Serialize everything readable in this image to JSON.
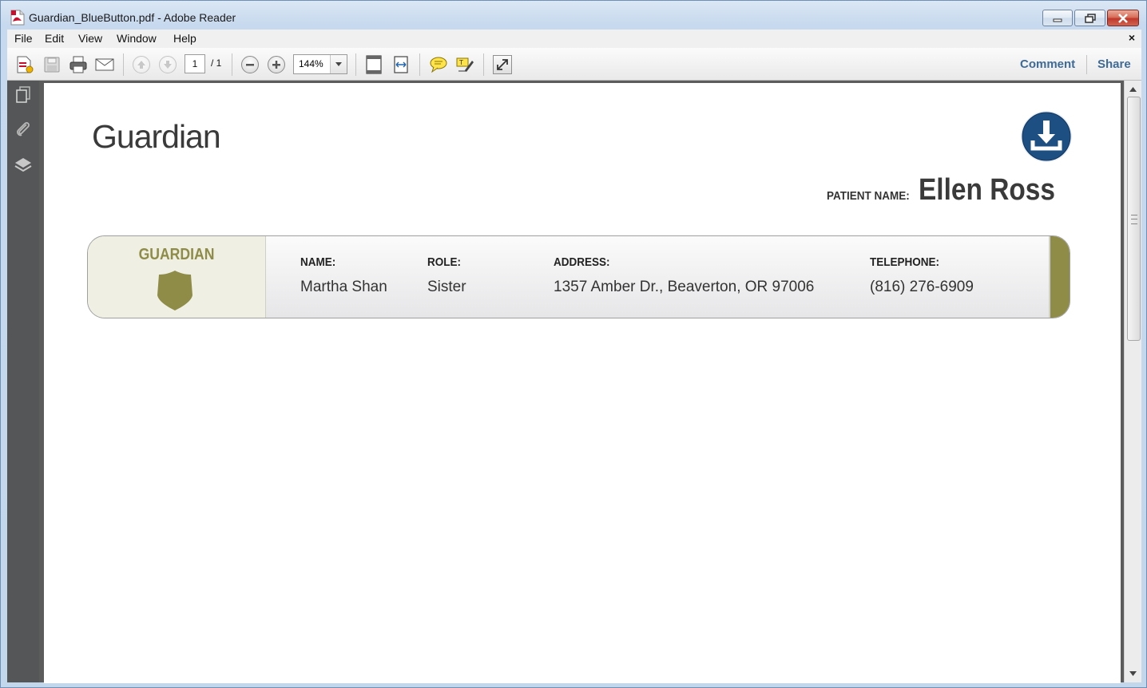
{
  "window": {
    "title": "Guardian_BlueButton.pdf - Adobe Reader",
    "menu": [
      "File",
      "Edit",
      "View",
      "Window",
      "Help"
    ],
    "menu_close": "×"
  },
  "toolbar": {
    "page_current": "1",
    "page_total": "/ 1",
    "zoom": "144%",
    "comment_label": "Comment",
    "share_label": "Share"
  },
  "document": {
    "title": "Guardian",
    "patient_label": "PATIENT NAME:",
    "patient_name": "Ellen Ross",
    "card": {
      "brand": "GUARDIAN",
      "name_label": "NAME:",
      "name_value": "Martha Shan",
      "role_label": "ROLE:",
      "role_value": "Sister",
      "address_label": "ADDRESS:",
      "address_value": "1357 Amber Dr., Beaverton, OR 97006",
      "telephone_label": "TELEPHONE:",
      "telephone_value": "(816) 276-6909"
    }
  },
  "colors": {
    "guardian_accent": "#8e8c46",
    "download_blue": "#1d4f82",
    "nav_pane": "#555658",
    "link_blue": "#3e6a98"
  },
  "icons": {
    "app": "pdf-file-icon",
    "nav": [
      "pages-icon",
      "attachment-icon",
      "layers-icon"
    ],
    "download": "download-icon"
  }
}
